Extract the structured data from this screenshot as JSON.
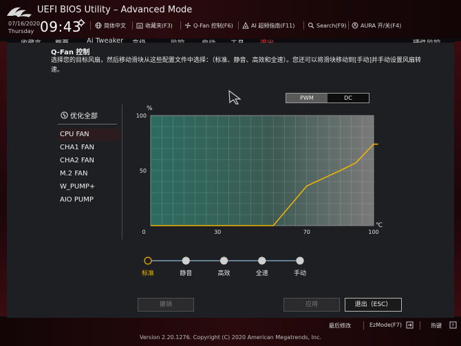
{
  "window": {
    "title": "UEFI BIOS Utility – Advanced Mode",
    "date": "07/16/2020",
    "day": "Thursday",
    "time": "09:43"
  },
  "toolbar": [
    {
      "icon": "globe-icon",
      "label": "简体中文"
    },
    {
      "icon": "favorites-icon",
      "label": "收藏夹(F3)"
    },
    {
      "icon": "fan-icon",
      "label": "Q-Fan 控制(F6)"
    },
    {
      "icon": "ai-icon",
      "label": "AI 超频指南(F11)"
    },
    {
      "icon": "search-icon",
      "label": "Search(F9)"
    },
    {
      "icon": "aura-icon",
      "label": "AURA 开/关(F4)"
    }
  ],
  "menu_tabs": [
    "收藏夹",
    "概要",
    "Ai Tweaker",
    "高级",
    "监控",
    "启动",
    "工具",
    "退出",
    "硬件监控"
  ],
  "qfan": {
    "title": "Q-Fan 控制",
    "description": "选择您的目标风扇，然后移动滑块从这些配置文件中选择：（标准、静音、高效和全速）。您还可以将滑块移动到[手动]并手动设置风扇转速。",
    "mode_options": [
      "PWM",
      "DC"
    ],
    "mode_selected": "PWM",
    "optimize_label": "优化全部",
    "fans": [
      "CPU FAN",
      "CHA1 FAN",
      "CHA2 FAN",
      "M.2 FAN",
      "W_PUMP+",
      "AIO PUMP"
    ],
    "fan_selected": "CPU FAN",
    "presets": [
      "标准",
      "静音",
      "高效",
      "全速",
      "手动"
    ],
    "preset_selected": "标准",
    "buttons": {
      "undo": "撤销",
      "apply": "应用",
      "exit": "退出（ESC）"
    }
  },
  "chart_data": {
    "type": "line",
    "xlabel": "℃",
    "ylabel": "%",
    "xlim": [
      0,
      100
    ],
    "ylim": [
      0,
      100
    ],
    "x_ticks": [
      0,
      30,
      70,
      100
    ],
    "y_ticks": [
      0,
      50,
      100
    ],
    "grid": true,
    "series": [
      {
        "x": [
          0,
          55,
          70,
          85,
          92,
          100,
          102
        ],
        "y": [
          0,
          0,
          36,
          50,
          57,
          74,
          74
        ],
        "color": "#f0b400"
      }
    ]
  },
  "bottom_bar": {
    "last_modified": "最后修改",
    "ezmode": "EzMode(F7)",
    "hotkeys": "热键",
    "version": "Version 2.20.1276. Copyright (C) 2020 American Megatrends, Inc."
  },
  "colors": {
    "accent": "#f0b400",
    "active_tab": "#ff3b3b",
    "background": "#1e1f22"
  }
}
